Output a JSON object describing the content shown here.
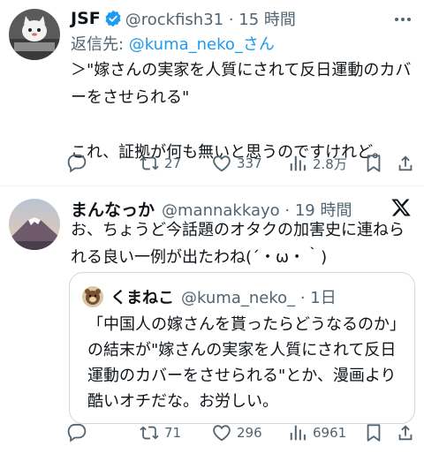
{
  "tweet1": {
    "name": "JSF",
    "handle_time": "@rockfish31 · 15 時間",
    "reply_prefix": "返信先: ",
    "reply_target": "@kuma_neko_さん",
    "text": "＞\"嫁さんの実家を人質にされて反日運動のカバーをさせられる\"\n\nこれ、証拠が何も無いと思うのですけれど。",
    "reply_count": "",
    "retweet_count": "27",
    "like_count": "337",
    "view_count": "2.8万"
  },
  "tweet2": {
    "name": "まんなっか",
    "handle_time": "@mannakkayo · 19 時間",
    "text": "お、ちょうど今話題のオタクの加害史に連ねられる良い一例が出たわね(´・ω・｀)",
    "reply_count": "",
    "retweet_count": "71",
    "like_count": "296",
    "view_count": "6961",
    "quote": {
      "name": "くまねこ",
      "handle_time": "@kuma_neko_ · 1日",
      "text": "「中国人の嫁さんを貰ったらどうなるのか」の結末が\"嫁さんの実家を人質にされて反日運動のカバーをさせられる\"とか、漫画より酷いオチだな。お労しい。"
    }
  },
  "colors": {
    "text": "#0f1419",
    "secondary": "#536471",
    "link": "#1d9bf0",
    "verified": "#1d9bf0",
    "divider": "#eff3f4"
  }
}
